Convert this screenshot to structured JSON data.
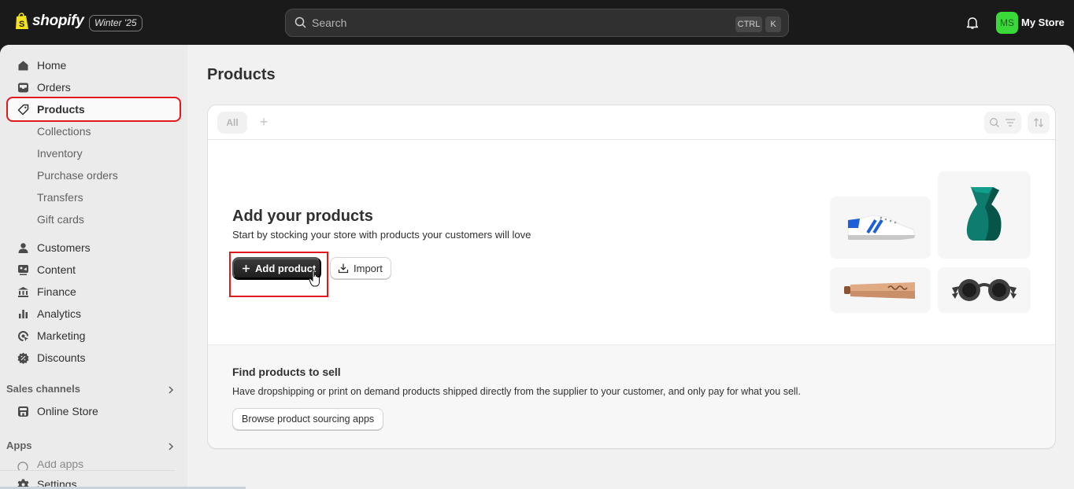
{
  "topbar": {
    "brand": "shopify",
    "edition_badge": "Winter '25",
    "search_placeholder": "Search",
    "shortcut_keys": [
      "CTRL",
      "K"
    ],
    "avatar_initials": "MS",
    "store_name": "My Store",
    "avatar_color": "#3ad93a"
  },
  "sidebar": {
    "items": [
      {
        "label": "Home",
        "icon": "home-icon"
      },
      {
        "label": "Orders",
        "icon": "inbox-icon"
      },
      {
        "label": "Products",
        "icon": "tag-icon",
        "active": true
      },
      {
        "label": "Collections",
        "sub": true
      },
      {
        "label": "Inventory",
        "sub": true
      },
      {
        "label": "Purchase orders",
        "sub": true
      },
      {
        "label": "Transfers",
        "sub": true
      },
      {
        "label": "Gift cards",
        "sub": true
      },
      {
        "label": "Customers",
        "icon": "person-icon"
      },
      {
        "label": "Content",
        "icon": "content-icon"
      },
      {
        "label": "Finance",
        "icon": "bank-icon"
      },
      {
        "label": "Analytics",
        "icon": "bar-chart-icon"
      },
      {
        "label": "Marketing",
        "icon": "target-icon"
      },
      {
        "label": "Discounts",
        "icon": "discount-icon"
      }
    ],
    "sales_channels_label": "Sales channels",
    "online_store_label": "Online Store",
    "apps_label": "Apps",
    "add_apps_label": "Add apps",
    "settings_label": "Settings"
  },
  "main": {
    "page_title": "Products",
    "tabs": {
      "all_label": "All",
      "add_label": "+"
    },
    "empty_state": {
      "title": "Add your products",
      "subtitle": "Start by stocking your store with products your customers will love",
      "add_product_label": "Add product",
      "import_label": "Import",
      "illustrations": [
        "sneaker",
        "vase",
        "tube",
        "sunglasses"
      ]
    },
    "find_products": {
      "title": "Find products to sell",
      "description": "Have dropshipping or print on demand products shipped directly from the supplier to your customer, and only pay for what you sell.",
      "button_label": "Browse product sourcing apps"
    }
  },
  "colors": {
    "highlight": "#e01b1b",
    "topbar_bg": "#1a1a1a",
    "primary_button": "#303030"
  }
}
